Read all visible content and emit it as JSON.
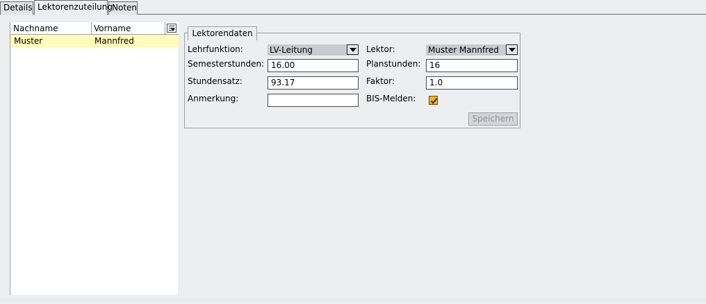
{
  "tabs": [
    "Details",
    "Lektorenzuteilung",
    "Noten"
  ],
  "list": {
    "columns": [
      "Nachname",
      "Vorname"
    ],
    "picker_icon": "column-picker-icon",
    "rows": [
      {
        "nachname": "Muster",
        "vorname": "Mannfred"
      }
    ],
    "selected_row_color": "#fffbb8"
  },
  "group": {
    "legend": "Lektorendaten",
    "labels": {
      "lehrfunktion": "Lehrfunktion:",
      "semesterstunden": "Semesterstunden:",
      "stundensatz": "Stundensatz:",
      "anmerkung": "Anmerkung:",
      "lektor": "Lektor:",
      "planstunden": "Planstunden:",
      "faktor": "Faktor:",
      "bis_melden": "BIS-Melden:"
    },
    "values": {
      "lehrfunktion": "LV-Leitung",
      "semesterstunden": "16.00",
      "stundensatz": "93.17",
      "anmerkung": "",
      "lektor": "Muster Mannfred",
      "planstunden": "16",
      "faktor": "1.0",
      "bis_melden": true
    },
    "save_label": "Speichern"
  }
}
